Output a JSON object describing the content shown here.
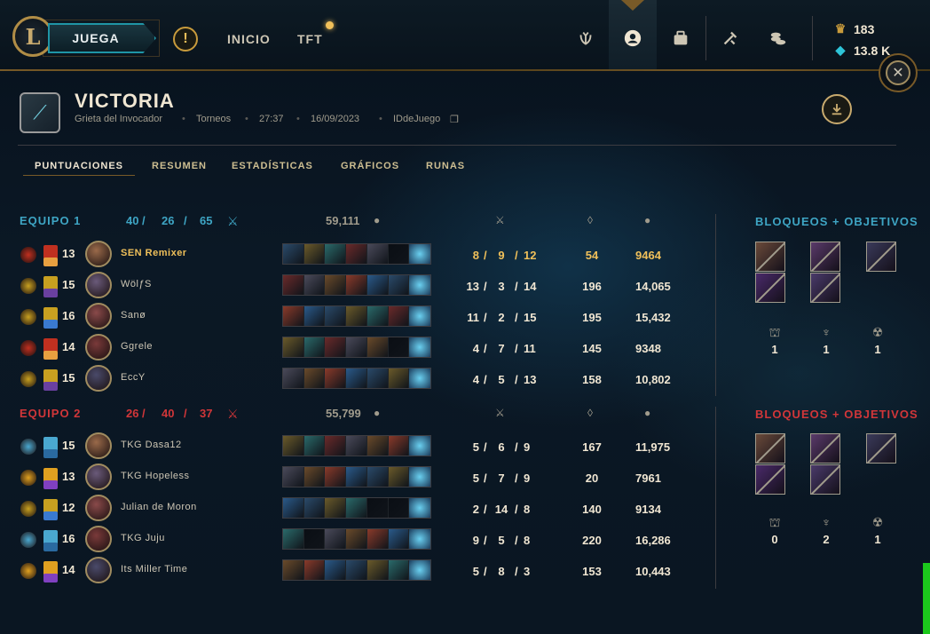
{
  "nav": {
    "play_label": "JUEGA",
    "home_label": "INICIO",
    "tft_label": "TFT",
    "currency": {
      "blue_essence": "183",
      "rp": "13.8 K"
    }
  },
  "match": {
    "result": "VICTORIA",
    "map": "Grieta del Invocador",
    "queue": "Torneos",
    "duration": "27:37",
    "date": "16/09/2023",
    "game_id_label": "IDdeJuego"
  },
  "tabs": [
    "PUNTUACIONES",
    "RESUMEN",
    "ESTADÍSTICAS",
    "GRÁFICOS",
    "RUNAS"
  ],
  "colors": {
    "team1": "#3ea5c4",
    "team2": "#d13639",
    "gold": "#f0c05a"
  },
  "teams": [
    {
      "name": "EQUIPO 1",
      "kills": "40",
      "deaths": "26",
      "assists": "65",
      "gold": "59,111",
      "bans_title": "BLOQUEOS + OBJETIVOS",
      "objectives": {
        "towers": "1",
        "dragons": "1",
        "barons": "1"
      },
      "players": [
        {
          "level": "13",
          "name": "SEN Remixer",
          "kda": [
            "8",
            "9",
            "12"
          ],
          "cs": "54",
          "gold": "9464",
          "self": true
        },
        {
          "level": "15",
          "name": "WölƒS",
          "kda": [
            "13",
            "3",
            "14"
          ],
          "cs": "196",
          "gold": "14,065"
        },
        {
          "level": "16",
          "name": "Sanø",
          "kda": [
            "11",
            "2",
            "15"
          ],
          "cs": "195",
          "gold": "15,432"
        },
        {
          "level": "14",
          "name": "Ggrele",
          "kda": [
            "4",
            "7",
            "11"
          ],
          "cs": "145",
          "gold": "9348"
        },
        {
          "level": "15",
          "name": "EccY",
          "kda": [
            "4",
            "5",
            "13"
          ],
          "cs": "158",
          "gold": "10,802"
        }
      ]
    },
    {
      "name": "EQUIPO 2",
      "kills": "26",
      "deaths": "40",
      "assists": "37",
      "gold": "55,799",
      "bans_title": "BLOQUEOS + OBJETIVOS",
      "objectives": {
        "towers": "0",
        "dragons": "2",
        "barons": "1"
      },
      "players": [
        {
          "level": "15",
          "name": "TKG Dasa12",
          "kda": [
            "5",
            "6",
            "9"
          ],
          "cs": "167",
          "gold": "11,975"
        },
        {
          "level": "13",
          "name": "TKG Hopeless",
          "kda": [
            "5",
            "7",
            "9"
          ],
          "cs": "20",
          "gold": "7961"
        },
        {
          "level": "12",
          "name": "Julian de Moron",
          "kda": [
            "2",
            "14",
            "8"
          ],
          "cs": "140",
          "gold": "9134"
        },
        {
          "level": "16",
          "name": "TKG Juju",
          "kda": [
            "9",
            "5",
            "8"
          ],
          "cs": "220",
          "gold": "16,286"
        },
        {
          "level": "14",
          "name": "Its Miller Time",
          "kda": [
            "5",
            "8",
            "3"
          ],
          "cs": "153",
          "gold": "10,443"
        }
      ]
    }
  ],
  "icons": {
    "close": "close-icon",
    "download": "download-icon",
    "kda": "crossed-swords-icon",
    "gold": "gold-coins-icon",
    "cs": "minion-icon"
  }
}
